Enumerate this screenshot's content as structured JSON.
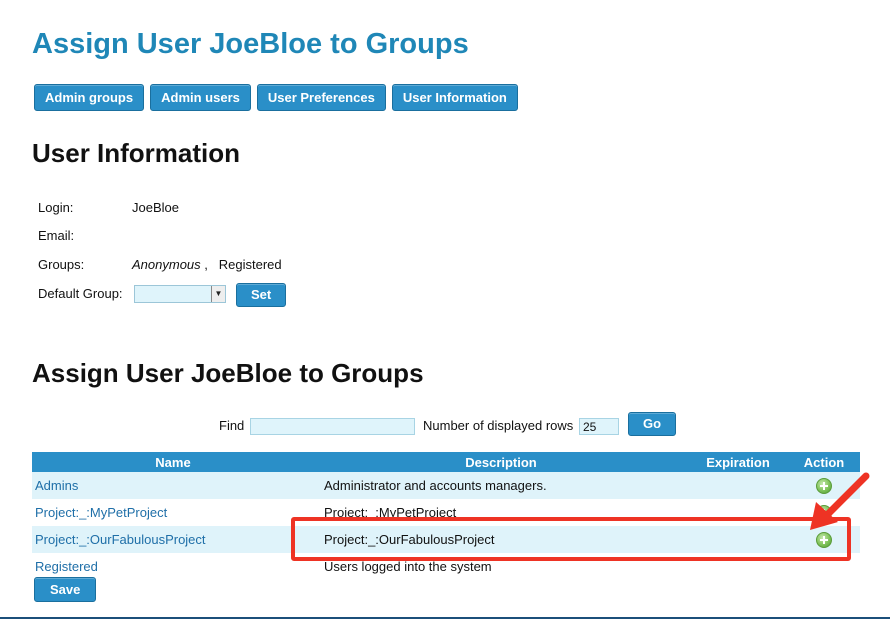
{
  "page": {
    "title": "Assign User JoeBloe to Groups"
  },
  "nav": {
    "admin_groups": "Admin groups",
    "admin_users": "Admin users",
    "user_preferences": "User Preferences",
    "user_information": "User Information"
  },
  "user_info": {
    "heading": "User Information",
    "login_label": "Login:",
    "login_value": "JoeBloe",
    "email_label": "Email:",
    "email_value": "",
    "groups_label": "Groups:",
    "group_anonymous": "Anonymous",
    "group_separator": ",",
    "group_registered": "Registered",
    "default_group_label": "Default Group:",
    "default_group_value": "",
    "set_button": "Set"
  },
  "assign": {
    "heading": "Assign User JoeBloe to Groups",
    "find_label": "Find",
    "find_value": "",
    "rows_label": "Number of displayed rows",
    "rows_value": "25",
    "go_button": "Go",
    "save_button": "Save"
  },
  "table": {
    "headers": {
      "name": "Name",
      "description": "Description",
      "expiration": "Expiration",
      "action": "Action"
    },
    "rows": [
      {
        "name": "Admins",
        "description": "Administrator and accounts managers.",
        "expiration": "",
        "action_icon": "add-icon"
      },
      {
        "name": "Project:_:MyPetProject",
        "description": "Project:_:MyPetProject",
        "expiration": "",
        "action_icon": "add-icon"
      },
      {
        "name": "Project:_:OurFabulousProject",
        "description": "Project:_:OurFabulousProject",
        "expiration": "",
        "action_icon": "add-icon"
      },
      {
        "name": "Registered",
        "description": "Users logged into the system",
        "expiration": "",
        "action_icon": ""
      }
    ]
  },
  "annotation": {
    "highlight_color": "#ee3324",
    "arrow_color": "#ee3324"
  },
  "colors": {
    "title": "#1f87b7",
    "button": "#2a8fc8",
    "row_alt": "#dff3fa",
    "link": "#1f6fa8"
  }
}
